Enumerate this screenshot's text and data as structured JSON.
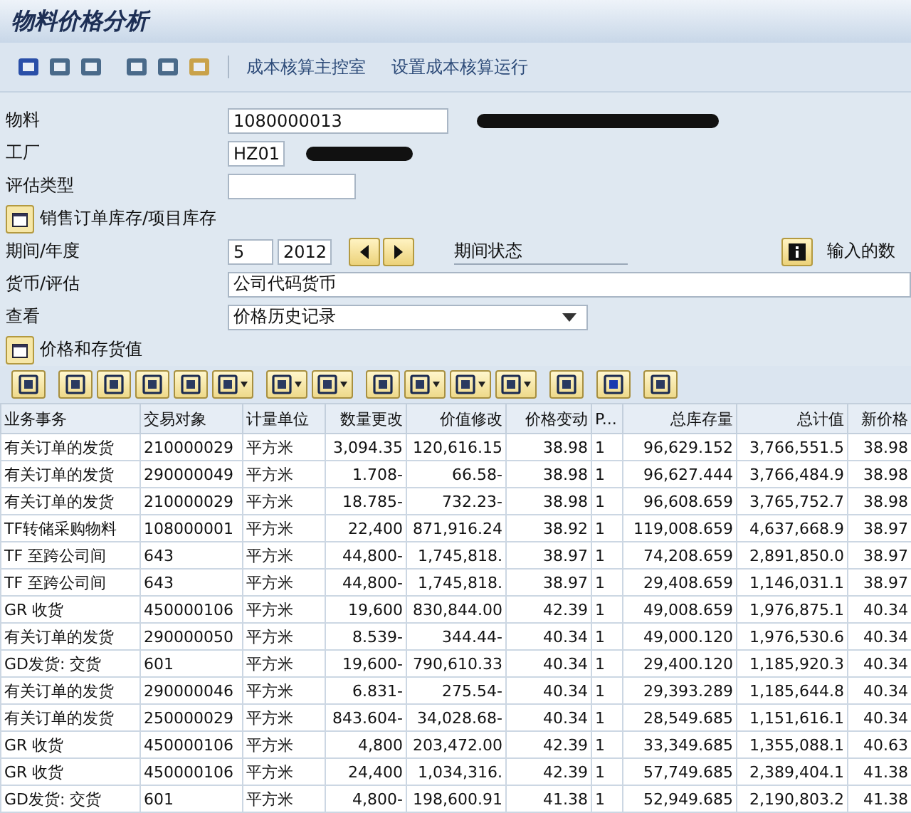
{
  "window": {
    "title": "物料价格分析"
  },
  "toolbar": {
    "links": [
      "成本核算主控室",
      "设置成本核算运行"
    ]
  },
  "form": {
    "material": {
      "label": "物料",
      "value": "1080000013"
    },
    "plant": {
      "label": "工厂",
      "value": "HZ01"
    },
    "valuation_type": {
      "label": "评估类型"
    },
    "sales_order_button": "销售订单库存/项目库存",
    "period": {
      "label": "期间/年度",
      "period": "5",
      "year": "2012",
      "status_label": "期间状态",
      "entered_label": "输入的数"
    },
    "currency": {
      "label": "货币/评估",
      "value": "公司代码货币"
    },
    "view": {
      "label": "查看",
      "value": "价格历史记录"
    },
    "section_button": "价格和存货值"
  },
  "table": {
    "columns": [
      "业务事务",
      "交易对象",
      "计量单位",
      "数量更改",
      "价值修改",
      "价格变动",
      "P...",
      "总库存量",
      "总计值",
      "新价格"
    ],
    "rows": [
      [
        "有关订单的发货",
        "210000029",
        "平方米",
        "3,094.35",
        "120,616.15",
        "38.98",
        "1",
        "96,629.152",
        "3,766,551.5",
        "38.98"
      ],
      [
        "有关订单的发货",
        "290000049",
        "平方米",
        "1.708-",
        "66.58-",
        "38.98",
        "1",
        "96,627.444",
        "3,766,484.9",
        "38.98"
      ],
      [
        "有关订单的发货",
        "210000029",
        "平方米",
        "18.785-",
        "732.23-",
        "38.98",
        "1",
        "96,608.659",
        "3,765,752.7",
        "38.98"
      ],
      [
        "TF转储采购物料",
        "108000001",
        "平方米",
        "22,400",
        "871,916.24",
        "38.92",
        "1",
        "119,008.659",
        "4,637,668.9",
        "38.97"
      ],
      [
        "TF 至跨公司间",
        "643",
        "平方米",
        "44,800-",
        "1,745,818.",
        "38.97",
        "1",
        "74,208.659",
        "2,891,850.0",
        "38.97"
      ],
      [
        "TF 至跨公司间",
        "643",
        "平方米",
        "44,800-",
        "1,745,818.",
        "38.97",
        "1",
        "29,408.659",
        "1,146,031.1",
        "38.97"
      ],
      [
        "GR 收货",
        "450000106",
        "平方米",
        "19,600",
        "830,844.00",
        "42.39",
        "1",
        "49,008.659",
        "1,976,875.1",
        "40.34"
      ],
      [
        "有关订单的发货",
        "290000050",
        "平方米",
        "8.539-",
        "344.44-",
        "40.34",
        "1",
        "49,000.120",
        "1,976,530.6",
        "40.34"
      ],
      [
        "GD发货: 交货",
        "601",
        "平方米",
        "19,600-",
        "790,610.33",
        "40.34",
        "1",
        "29,400.120",
        "1,185,920.3",
        "40.34"
      ],
      [
        "有关订单的发货",
        "290000046",
        "平方米",
        "6.831-",
        "275.54-",
        "40.34",
        "1",
        "29,393.289",
        "1,185,644.8",
        "40.34"
      ],
      [
        "有关订单的发货",
        "250000029",
        "平方米",
        "843.604-",
        "34,028.68-",
        "40.34",
        "1",
        "28,549.685",
        "1,151,616.1",
        "40.34"
      ],
      [
        "GR 收货",
        "450000106",
        "平方米",
        "4,800",
        "203,472.00",
        "42.39",
        "1",
        "33,349.685",
        "1,355,088.1",
        "40.63"
      ],
      [
        "GR 收货",
        "450000106",
        "平方米",
        "24,400",
        "1,034,316.",
        "42.39",
        "1",
        "57,749.685",
        "2,389,404.1",
        "41.38"
      ],
      [
        "GD发货: 交货",
        "601",
        "平方米",
        "4,800-",
        "198,600.91",
        "41.38",
        "1",
        "52,949.685",
        "2,190,803.2",
        "41.38"
      ]
    ]
  }
}
